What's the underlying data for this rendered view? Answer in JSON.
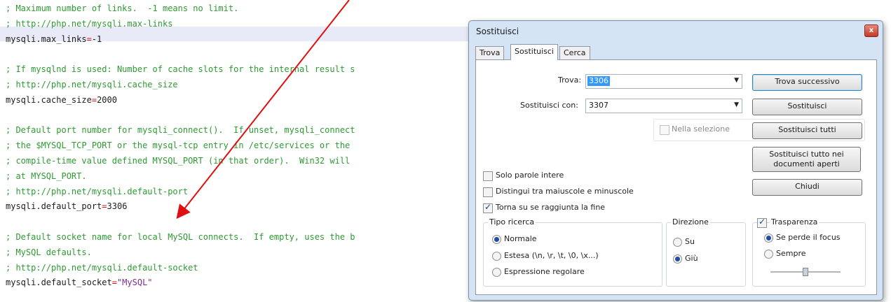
{
  "editor": {
    "lines": [
      {
        "type": "comment",
        "text": "; Maximum number of links.  -1 means no limit."
      },
      {
        "type": "comment",
        "text": "; http://php.net/mysqli.max-links"
      },
      {
        "type": "setting",
        "key": "mysqli.max_links",
        "op": "=",
        "value": "-1"
      },
      {
        "type": "blank",
        "text": ""
      },
      {
        "type": "comment",
        "text": "; If mysqlnd is used: Number of cache slots for the internal result s"
      },
      {
        "type": "comment",
        "text": "; http://php.net/mysqli.cache_size"
      },
      {
        "type": "setting",
        "key": "mysqli.cache_size",
        "op": "=",
        "value": "2000"
      },
      {
        "type": "blank",
        "text": ""
      },
      {
        "type": "comment",
        "text": "; Default port number for mysqli_connect().  If unset, mysqli_connect"
      },
      {
        "type": "comment",
        "text": "; the $MYSQL_TCP_PORT or the mysql-tcp entry in /etc/services or the"
      },
      {
        "type": "comment",
        "text": "; compile-time value defined MYSQL_PORT (in that order).  Win32 will"
      },
      {
        "type": "comment",
        "text": "; at MYSQL_PORT."
      },
      {
        "type": "comment",
        "text": "; http://php.net/mysqli.default-port"
      },
      {
        "type": "setting",
        "key": "mysqli.default_port",
        "op": "=",
        "value": "3306"
      },
      {
        "type": "blank",
        "text": ""
      },
      {
        "type": "comment",
        "text": "; Default socket name for local MySQL connects.  If empty, uses the b"
      },
      {
        "type": "comment",
        "text": "; MySQL defaults."
      },
      {
        "type": "comment",
        "text": "; http://php.net/mysqli.default-socket"
      },
      {
        "type": "setting",
        "key": "mysqli.default_socket",
        "op": "=",
        "value": "\"MySQL\""
      }
    ]
  },
  "dialog": {
    "title": "Sostituisci",
    "close_label": "x",
    "tabs": [
      "Trova",
      "Sostituisci",
      "Cerca nei file"
    ],
    "active_tab": 1,
    "find_label": "Trova:",
    "find_value": "3306",
    "replace_label": "Sostituisci con:",
    "replace_value": "3307",
    "in_selection_label": "Nella selezione",
    "buttons": {
      "find_next": "Trova successivo",
      "replace": "Sostituisci",
      "replace_all": "Sostituisci tutti",
      "replace_all_open_line1": "Sostituisci tutto nei",
      "replace_all_open_line2": "documenti aperti",
      "close": "Chiudi"
    },
    "options": {
      "whole_words": "Solo parole intere",
      "match_case": "Distingui tra maiuscole e minuscole",
      "wrap_around": "Torna su se raggiunta la fine"
    },
    "search_type": {
      "title": "Tipo ricerca",
      "normal": "Normale",
      "extended": "Estesa (\\n, \\r, \\t, \\0, \\x...)",
      "regex": "Espressione regolare"
    },
    "direction": {
      "title": "Direzione",
      "up": "Su",
      "down": "Giù"
    },
    "transparency": {
      "title": "Trasparenza",
      "on_lose_focus": "Se perde il focus",
      "always": "Sempre"
    }
  },
  "colors": {
    "comment": "#2e9a32",
    "operator": "#d01818",
    "annotation_arrow": "#e01010",
    "highlight_line": "#e9eaf7"
  }
}
